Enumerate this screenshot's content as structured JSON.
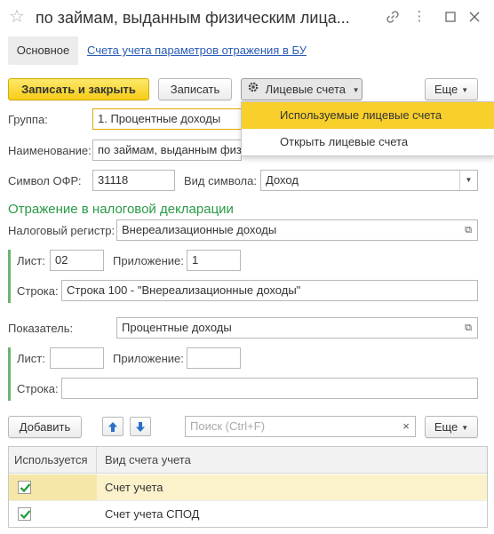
{
  "window": {
    "title": "по займам, выданным физическим лица...",
    "star_icon": "star-icon",
    "link_icon": "link-icon",
    "menu_icon": "more-vertical-icon",
    "maximize_icon": "maximize-icon",
    "close_icon": "close-icon"
  },
  "nav": {
    "main_label": "Основное",
    "link_label": "Счета учета параметров отражения в БУ"
  },
  "toolbar": {
    "save_close_label": "Записать и закрыть",
    "save_label": "Записать",
    "accounts_label": "Лицевые счета",
    "more_label": "Еще"
  },
  "accounts_menu": {
    "items": [
      {
        "label": "Используемые лицевые счета",
        "highlighted": true
      },
      {
        "label": "Открыть лицевые счета",
        "highlighted": false
      }
    ]
  },
  "form": {
    "group_label": "Группа:",
    "group_value": "1. Процентные доходы",
    "name_label": "Наименование:",
    "name_value": "по займам, выданным физ",
    "symbol_label": "Символ ОФР:",
    "symbol_value": "31118",
    "kind_label": "Вид символа:",
    "kind_value": "Доход"
  },
  "tax": {
    "section_title": "Отражение в налоговой декларации",
    "register_label": "Налоговый регистр:",
    "register_value": "Внереализационные доходы",
    "sheet_label": "Лист:",
    "sheet_value": "02",
    "appendix_label": "Приложение:",
    "appendix_value": "1",
    "row_label": "Строка:",
    "row_value": "Строка 100 - \"Внереализационные доходы\""
  },
  "indicator": {
    "label": "Показатель:",
    "value": "Процентные доходы",
    "sheet_label": "Лист:",
    "sheet_value": "",
    "appendix_label": "Приложение:",
    "appendix_value": "",
    "row_label": "Строка:",
    "row_value": ""
  },
  "table_toolbar": {
    "add_label": "Добавить",
    "search_placeholder": "Поиск (Ctrl+F)",
    "more_label": "Еще"
  },
  "table": {
    "columns": [
      "Используется",
      "Вид счета учета"
    ],
    "rows": [
      {
        "used": true,
        "kind": "Счет учета",
        "selected": true
      },
      {
        "used": true,
        "kind": "Счет учета СПОД",
        "selected": false
      }
    ]
  },
  "colors": {
    "accent": "#f6cd18",
    "section_green": "#2a9a47",
    "link_blue": "#2a5bb5",
    "check_green": "#1f9a3a"
  }
}
